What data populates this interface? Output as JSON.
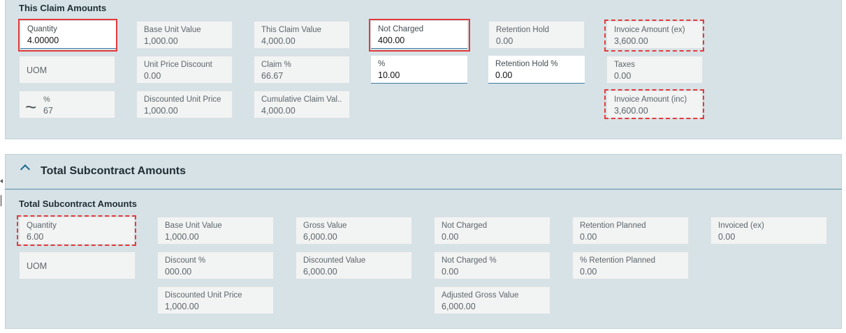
{
  "this_claim": {
    "title": "This Claim Amounts",
    "quantity": {
      "label": "Quantity",
      "value": "4.00000"
    },
    "base_unit_value": {
      "label": "Base Unit Value",
      "value": "1,000.00"
    },
    "this_claim_value": {
      "label": "This Claim Value",
      "value": "4,000.00"
    },
    "not_charged": {
      "label": "Not Charged",
      "value": "400.00"
    },
    "retention_hold": {
      "label": "Retention Hold",
      "value": "0.00"
    },
    "invoice_amount_ex": {
      "label": "Invoice Amount (ex)",
      "value": "3,600.00"
    },
    "uom": {
      "label": "UOM"
    },
    "unit_price_discount": {
      "label": "Unit Price Discount",
      "value": "0.00"
    },
    "claim_pct": {
      "label": "Claim %",
      "value": "66.67"
    },
    "pct": {
      "label": "%",
      "value": "10.00"
    },
    "retention_hold_pct": {
      "label": "Retention Hold %",
      "value": "0.00"
    },
    "taxes": {
      "label": "Taxes",
      "value": "0.00"
    },
    "approx_pct": {
      "symbol": "~",
      "label": "%",
      "value": "67"
    },
    "discounted_unit_price": {
      "label": "Discounted Unit Price",
      "value": "1,000.00"
    },
    "cumulative_claim_value": {
      "label": "Cumulative Claim Val...",
      "value": "4,000.00"
    },
    "invoice_amount_inc": {
      "label": "Invoice Amount (inc)",
      "value": "3,600.00"
    }
  },
  "total_subcontract": {
    "header_title": "Total Subcontract Amounts",
    "title": "Total Subcontract Amounts",
    "quantity": {
      "label": "Quantity",
      "value": "6.00"
    },
    "base_unit_value": {
      "label": "Base Unit Value",
      "value": "1,000.00"
    },
    "gross_value": {
      "label": "Gross Value",
      "value": "6,000.00"
    },
    "not_charged": {
      "label": "Not Charged",
      "value": "0.00"
    },
    "retention_planned": {
      "label": "Retention Planned",
      "value": "0.00"
    },
    "invoiced_ex": {
      "label": "Invoiced (ex)",
      "value": "0.00"
    },
    "uom": {
      "label": "UOM"
    },
    "discount_pct": {
      "label": "Discount %",
      "value": "000.00"
    },
    "discounted_value": {
      "label": "Discounted Value",
      "value": "6,000.00"
    },
    "not_charged_pct": {
      "label": "Not Charged %",
      "value": "0.00"
    },
    "pct_retention_planned": {
      "label": "% Retention Planned",
      "value": "0.00"
    },
    "discounted_unit_price": {
      "label": "Discounted Unit Price",
      "value": "1,000.00"
    },
    "adjusted_gross_value": {
      "label": "Adjusted Gross Value",
      "value": "6,000.00"
    }
  },
  "colors": {
    "panel": "#d6e2e6",
    "highlight": "#e23b3b",
    "accent": "#1d6a8f"
  }
}
